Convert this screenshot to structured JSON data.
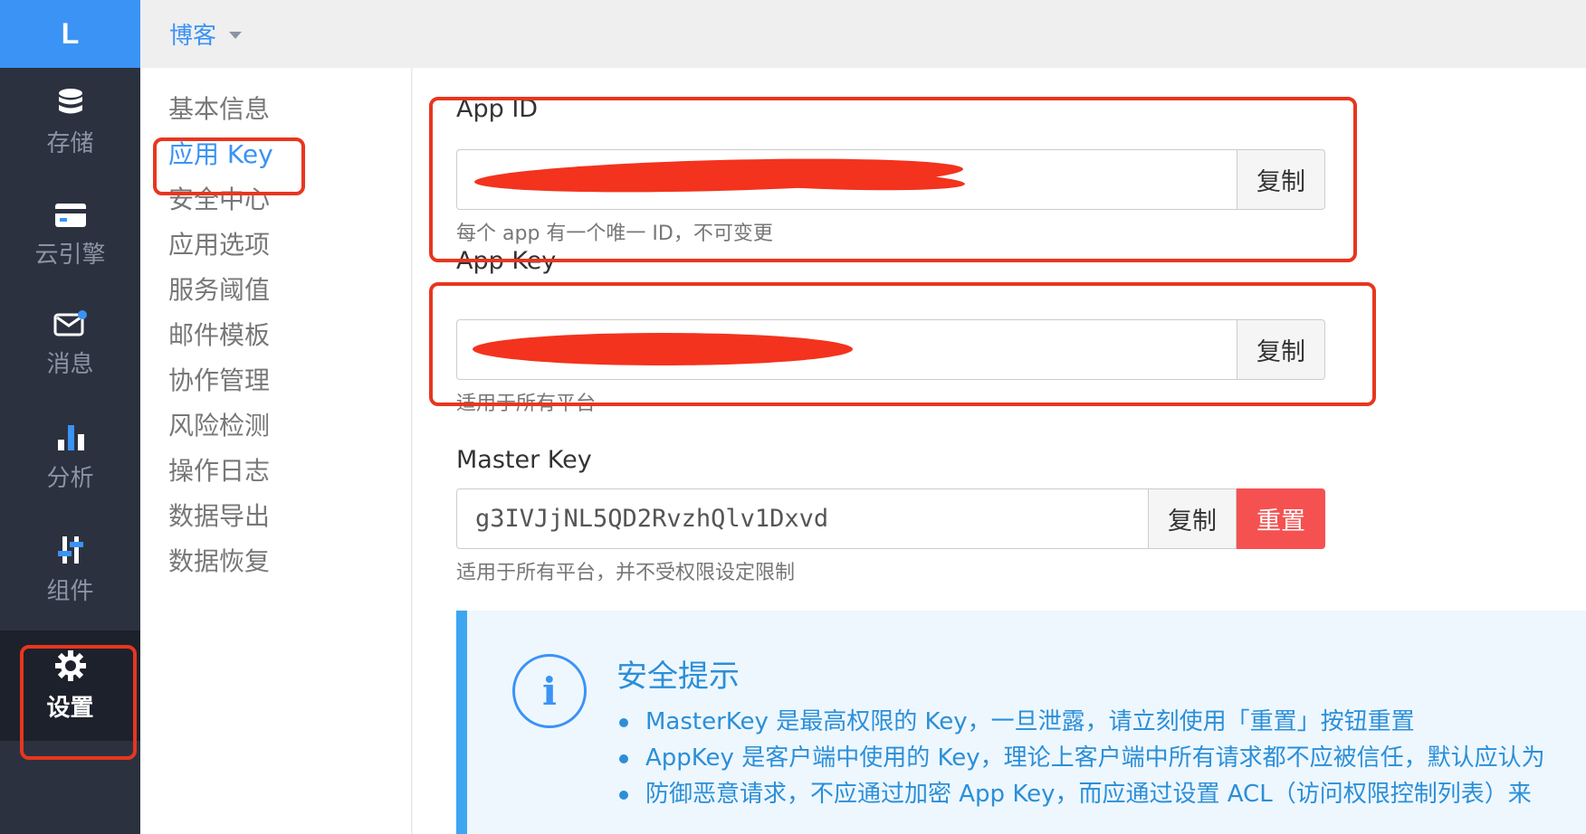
{
  "logo": "L",
  "app_switcher": {
    "name": "博客"
  },
  "rail": [
    {
      "label": "存储",
      "icon": "database-icon"
    },
    {
      "label": "云引擎",
      "icon": "card-icon"
    },
    {
      "label": "消息",
      "icon": "message-icon"
    },
    {
      "label": "分析",
      "icon": "bar-chart-icon"
    },
    {
      "label": "组件",
      "icon": "sliders-icon"
    },
    {
      "label": "设置",
      "icon": "gear-icon",
      "active": true
    }
  ],
  "subnav": [
    "基本信息",
    "应用 Key",
    "安全中心",
    "应用选项",
    "服务阈值",
    "邮件模板",
    "协作管理",
    "风险检测",
    "操作日志",
    "数据导出",
    "数据恢复"
  ],
  "subnav_active": "应用 Key",
  "fields": {
    "app_id": {
      "label": "App ID",
      "value": "",
      "copy": "复制",
      "help": "每个 app 有一个唯一 ID，不可变更"
    },
    "app_key": {
      "label": "App Key",
      "value": "",
      "copy": "复制",
      "help": "适用于所有平台"
    },
    "master_key": {
      "label": "Master Key",
      "value": "g3IVJjNL5QD2RvzhQlv1Dxvd",
      "copy": "复制",
      "reset": "重置",
      "help": "适用于所有平台，并不受权限设定限制"
    }
  },
  "tip": {
    "icon_glyph": "i",
    "title": "安全提示",
    "items": [
      "MasterKey 是最高权限的 Key，一旦泄露，请立刻使用「重置」按钮重置",
      "AppKey 是客户端中使用的 Key，理论上客户端中所有请求都不应被信任，默认应认为",
      "防御恶意请求，不应通过加密 App Key，而应通过设置 ACL（访问权限控制列表）来"
    ]
  },
  "colors": {
    "accent": "#3a93f5",
    "rail_bg": "#2c3140",
    "danger": "#f55151",
    "annotation": "#e8361f"
  }
}
